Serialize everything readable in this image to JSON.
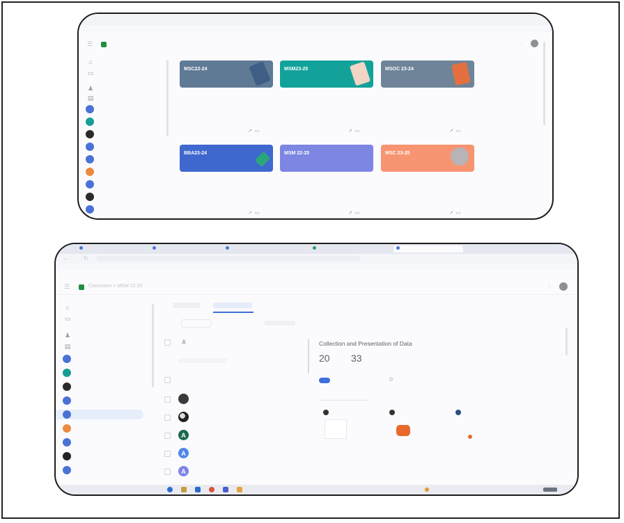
{
  "colors": {
    "card_slate": "#5f7a95",
    "card_teal": "#13a29a",
    "card_gray": "#6f8499",
    "card_blue": "#3f68cf",
    "card_lavender": "#7d86e2",
    "card_salmon": "#f79471",
    "accent_blue": "#3f6fdb"
  },
  "screenshot1": {
    "classes": [
      {
        "title": "MSC22-24",
        "subtitle": "",
        "color": "#5f7a95"
      },
      {
        "title": "MSM23-25",
        "subtitle": "",
        "color": "#13a29a"
      },
      {
        "title": "MSOC 23-24",
        "subtitle": "",
        "color": "#6f8499"
      },
      {
        "title": "BBA23-24",
        "subtitle": "",
        "color": "#3f68cf"
      },
      {
        "title": "MSM 22-25",
        "subtitle": "",
        "color": "#7d86e2"
      },
      {
        "title": "MSC 23-25",
        "subtitle": "",
        "color": "#f79471"
      }
    ],
    "card_action_icons": [
      "trend-icon",
      "folder-icon"
    ]
  },
  "screenshot2": {
    "breadcrumb": {
      "app": "Classroom",
      "separator": ">",
      "class_name": "MSM 22-25"
    },
    "assignment": {
      "title": "Collection and Presentation of Data",
      "counts": [
        "20",
        "33"
      ]
    }
  }
}
